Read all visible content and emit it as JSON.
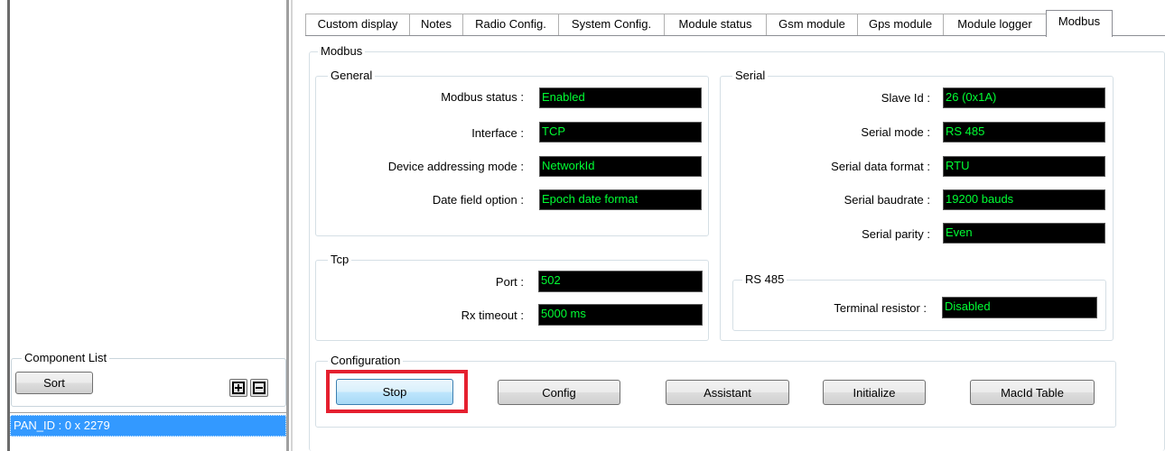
{
  "tabs": [
    {
      "label": "Custom display"
    },
    {
      "label": "Notes"
    },
    {
      "label": "Radio Config."
    },
    {
      "label": "System Config."
    },
    {
      "label": "Module status"
    },
    {
      "label": "Gsm module"
    },
    {
      "label": "Gps module"
    },
    {
      "label": "Module logger"
    },
    {
      "label": "Modbus"
    }
  ],
  "modbus": {
    "title": "Modbus",
    "general": {
      "title": "General",
      "rows": [
        {
          "label": "Modbus status :",
          "value": "Enabled"
        },
        {
          "label": "Interface :",
          "value": "TCP"
        },
        {
          "label": "Device addressing mode :",
          "value": "NetworkId"
        },
        {
          "label": "Date field option :",
          "value": "Epoch date format"
        }
      ]
    },
    "tcp": {
      "title": "Tcp",
      "rows": [
        {
          "label": "Port :",
          "value": "502"
        },
        {
          "label": "Rx timeout :",
          "value": "5000 ms"
        }
      ]
    },
    "serial": {
      "title": "Serial",
      "rows": [
        {
          "label": "Slave Id :",
          "value": "26 (0x1A)"
        },
        {
          "label": "Serial mode :",
          "value": "RS 485"
        },
        {
          "label": "Serial data format :",
          "value": "RTU"
        },
        {
          "label": "Serial baudrate :",
          "value": "19200 bauds"
        },
        {
          "label": "Serial parity :",
          "value": "Even"
        }
      ]
    },
    "rs485": {
      "title": "RS 485",
      "rows": [
        {
          "label": "Terminal resistor :",
          "value": "Disabled"
        }
      ]
    },
    "configuration": {
      "title": "Configuration",
      "buttons": {
        "stop": "Stop",
        "config": "Config",
        "assistant": "Assistant",
        "initialize": "Initialize",
        "macid_table": "MacId Table"
      }
    }
  },
  "component_list": {
    "title": "Component List",
    "sort_label": "Sort",
    "items": [
      "PAN_ID : 0 x 2279"
    ]
  },
  "colors": {
    "field_bg": "#000000",
    "field_text": "#00ff33",
    "highlight": "#e5202f",
    "selection": "#3399ff"
  }
}
